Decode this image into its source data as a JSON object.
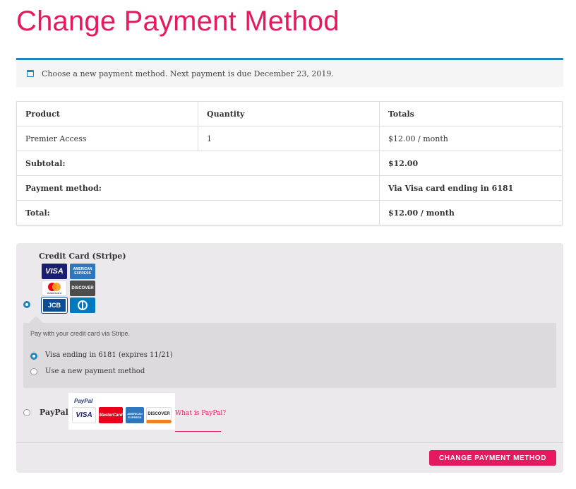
{
  "page": {
    "title": "Change Payment Method"
  },
  "notice": {
    "icon": "calendar-icon",
    "text": "Choose a new payment method. Next payment is due December 23, 2019."
  },
  "order_table": {
    "headers": [
      "Product",
      "Quantity",
      "Totals"
    ],
    "item": {
      "product": "Premier Access",
      "quantity": "1",
      "total": "$12.00 / month"
    },
    "subtotal_label": "Subtotal:",
    "subtotal_value": "$12.00",
    "payment_method_label": "Payment method:",
    "payment_method_value": "Via Visa card ending in 6181",
    "total_label": "Total:",
    "total_value": "$12.00 / month"
  },
  "payment": {
    "stripe": {
      "title": "Credit Card (Stripe)",
      "selected": true,
      "cards": [
        {
          "name": "VISA",
          "color": "#1a1f71"
        },
        {
          "name": "AMERICAN EXPRESS",
          "color": "#2e77bc"
        },
        {
          "name": "mastercard",
          "color": "#ffffff"
        },
        {
          "name": "DISCOVER",
          "color": "#4d4d4d"
        },
        {
          "name": "JCB",
          "color": "#0e4c96"
        },
        {
          "name": "Diners",
          "color": "#0079be"
        }
      ],
      "description": "Pay with your credit card via Stripe.",
      "saved_option": "Visa ending in 6181 (expires 11/21)",
      "new_option": "Use a new payment method"
    },
    "paypal": {
      "title": "PayPal",
      "selected": false,
      "logo_text": "PayPal",
      "cards": [
        "VISA",
        "MasterCard",
        "AMERICAN EXPRESS",
        "DISCOVER"
      ],
      "link": "What is PayPal?"
    },
    "submit_label": "CHANGE PAYMENT METHOD"
  },
  "colors": {
    "accent": "#e5195f",
    "info": "#1e85be"
  }
}
